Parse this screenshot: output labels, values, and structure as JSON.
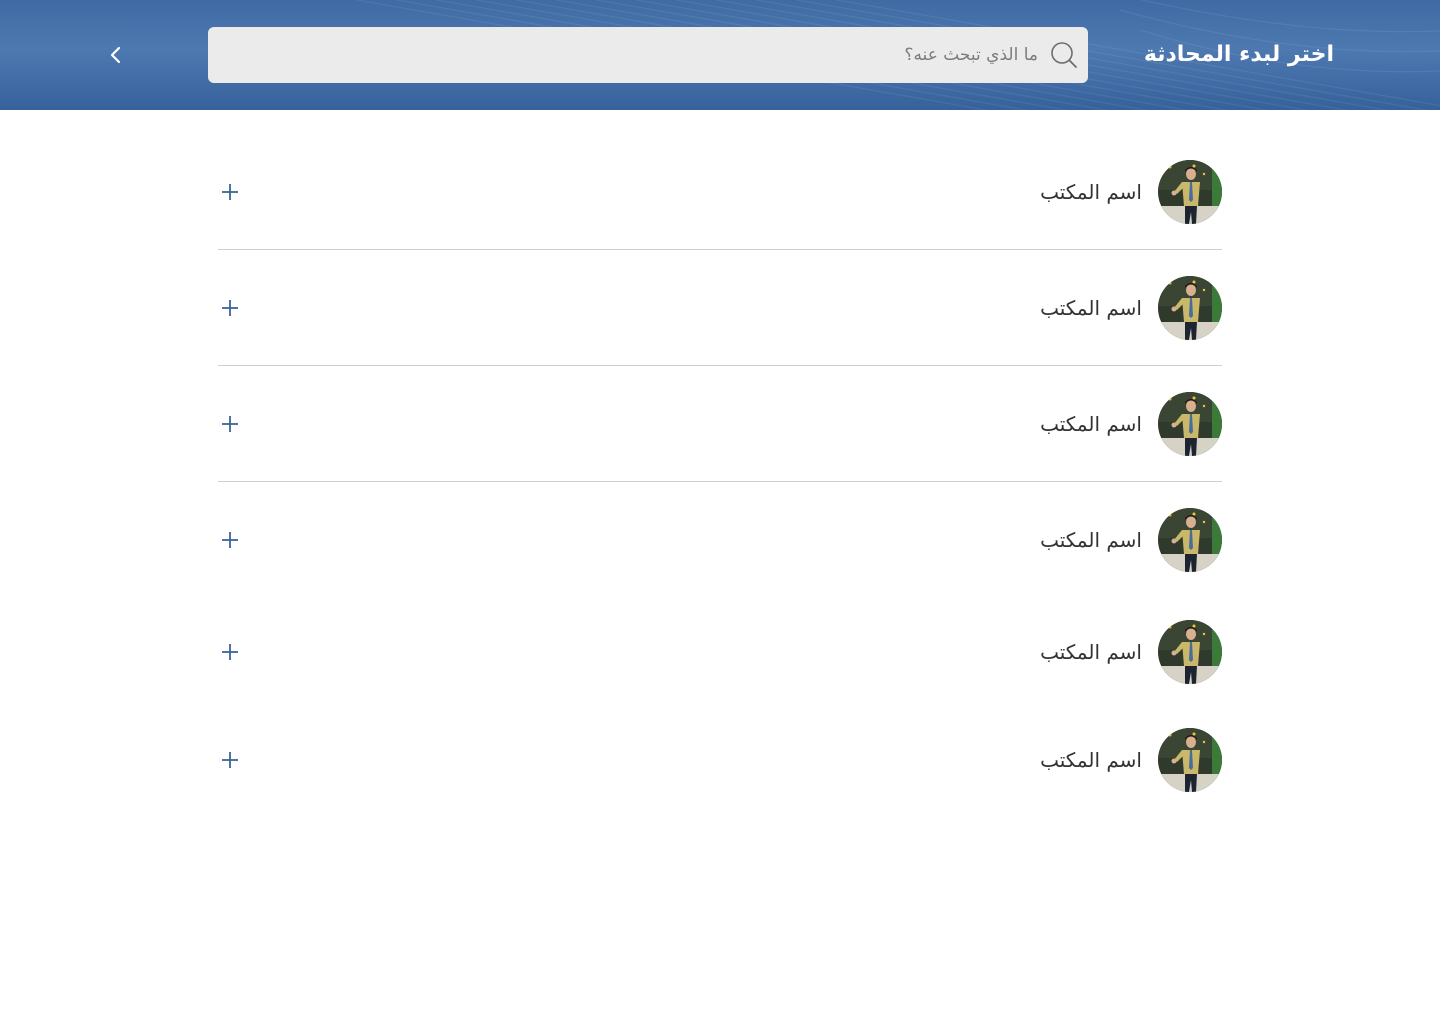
{
  "header": {
    "title": "اختر لبدء المحادثة",
    "back_icon": "chevron-right-icon"
  },
  "search": {
    "placeholder": "ما الذي تبحث عنه؟",
    "value": "",
    "icon": "search-icon"
  },
  "offices": [
    {
      "name": "اسم المكتب",
      "action_icon": "plus-icon"
    },
    {
      "name": "اسم المكتب",
      "action_icon": "plus-icon"
    },
    {
      "name": "اسم المكتب",
      "action_icon": "plus-icon"
    },
    {
      "name": "اسم المكتب",
      "action_icon": "plus-icon"
    },
    {
      "name": "اسم المكتب",
      "action_icon": "plus-icon"
    },
    {
      "name": "اسم المكتب",
      "action_icon": "plus-icon"
    }
  ],
  "colors": {
    "header": "#4670a8",
    "accent": "#2f5c96",
    "search_bg": "#ebebeb",
    "divider": "#cfcfcf"
  }
}
